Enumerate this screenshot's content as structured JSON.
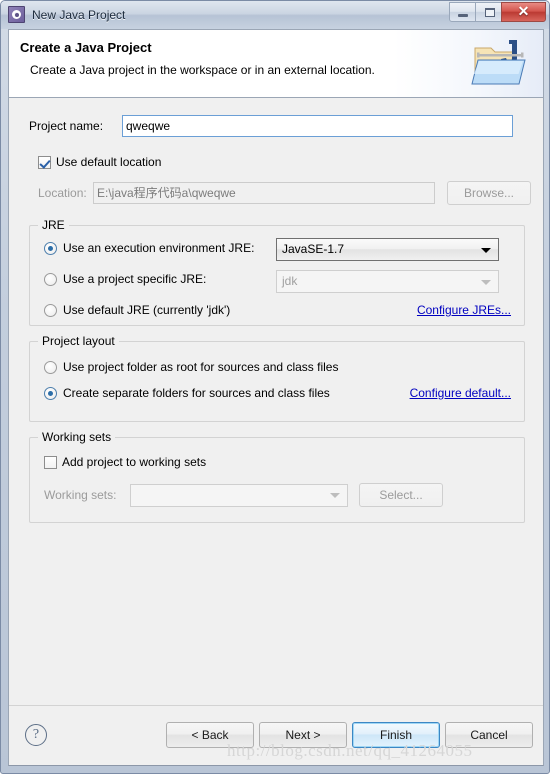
{
  "window": {
    "title": "New Java Project",
    "icon": "eclipse-wizard-icon",
    "controls": {
      "minimize": "–",
      "maximize": "❐",
      "close": "✕"
    }
  },
  "header": {
    "title": "Create a Java Project",
    "description": "Create a Java project in the workspace or in an external location.",
    "icon": "java-project-folder-icon"
  },
  "form": {
    "project_name": {
      "label": "Project name:",
      "value": "qweqwe",
      "placeholder": ""
    },
    "use_default_location": {
      "label": "Use default location",
      "checked": true
    },
    "location": {
      "label": "Location:",
      "value": "E:\\java程序代码a\\qweqwe",
      "browse_label": "Browse...",
      "disabled": true
    }
  },
  "jre_group": {
    "title": "JRE",
    "options": [
      {
        "label": "Use an execution environment JRE:",
        "selected": true,
        "combo_value": "JavaSE-1.7",
        "combo_disabled": false
      },
      {
        "label": "Use a project specific JRE:",
        "selected": false,
        "combo_value": "jdk",
        "combo_disabled": true
      },
      {
        "label": "Use default JRE (currently 'jdk')",
        "selected": false
      }
    ],
    "configure_link": "Configure JREs..."
  },
  "project_layout_group": {
    "title": "Project layout",
    "options": [
      {
        "label": "Use project folder as root for sources and class files",
        "selected": false
      },
      {
        "label": "Create separate folders for sources and class files",
        "selected": true
      }
    ],
    "configure_link": "Configure default..."
  },
  "working_sets_group": {
    "title": "Working sets",
    "checkbox": {
      "label": "Add project to working sets",
      "checked": false
    },
    "combo": {
      "label": "Working sets:",
      "value": "",
      "disabled": true
    },
    "select_button": "Select..."
  },
  "button_bar": {
    "help": "?",
    "back": "< Back",
    "next": "Next >",
    "finish": "Finish",
    "cancel": "Cancel"
  },
  "watermark": "http://blog.csdn.net/qq_41264055",
  "colors": {
    "dialog_background": "#f0f0f0",
    "link": "#0000c0",
    "default_button_border": "#3c87c4",
    "title_text": "#1c2b3d"
  }
}
